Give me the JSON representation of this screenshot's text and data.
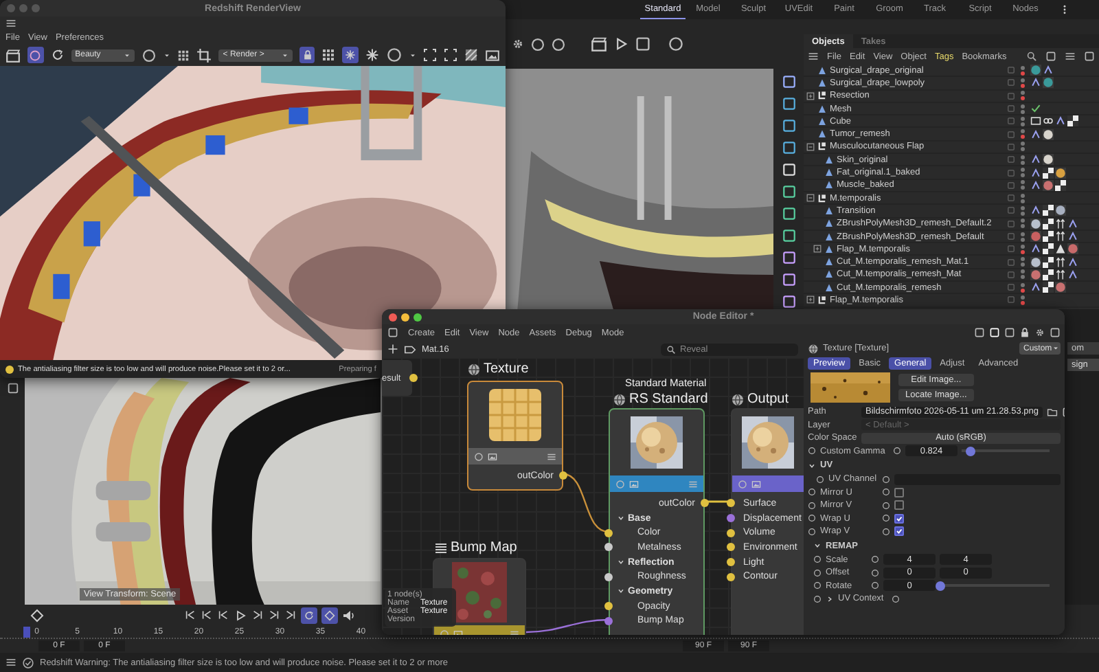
{
  "modes": [
    {
      "label": "Standard",
      "selected": true
    },
    {
      "label": "Model",
      "selected": false
    },
    {
      "label": "Sculpt",
      "selected": false
    },
    {
      "label": "UVEdit",
      "selected": false
    },
    {
      "label": "Paint",
      "selected": false
    },
    {
      "label": "Groom",
      "selected": false
    },
    {
      "label": "Track",
      "selected": false
    },
    {
      "label": "Script",
      "selected": false
    },
    {
      "label": "Nodes",
      "selected": false
    }
  ],
  "viewport": {
    "overlay_label": "View Transform: Scene"
  },
  "objects_panel": {
    "tabs": [
      {
        "label": "Objects",
        "selected": true
      },
      {
        "label": "Takes",
        "selected": false
      }
    ],
    "menu": [
      {
        "label": "File",
        "highlighted": false
      },
      {
        "label": "Edit",
        "highlighted": false
      },
      {
        "label": "View",
        "highlighted": false
      },
      {
        "label": "Object",
        "highlighted": false
      },
      {
        "label": "Tags",
        "highlighted": true
      },
      {
        "label": "Bookmarks",
        "highlighted": false
      }
    ],
    "items": [
      {
        "name": "Surgical_drape_original",
        "kind": "mesh",
        "render_off": true,
        "tags": [
          {
            "kind": "material",
            "color": "#3a9a9a"
          },
          {
            "kind": "uv"
          }
        ]
      },
      {
        "name": "Surgical_drape_lowpoly",
        "kind": "mesh",
        "render_off": true,
        "tags": [
          {
            "kind": "uv"
          },
          {
            "kind": "material",
            "color": "#3a9a9a"
          }
        ]
      },
      {
        "name": "Resection",
        "kind": "group",
        "render_off": true,
        "expanded": false
      },
      {
        "name": "Mesh",
        "kind": "mesh",
        "render_off": false,
        "tags": [
          {
            "kind": "check"
          }
        ]
      },
      {
        "name": "Cube",
        "kind": "mesh",
        "render_off": false,
        "tags": [
          {
            "kind": "display"
          },
          {
            "kind": "compositing"
          },
          {
            "kind": "uv"
          },
          {
            "kind": "checker"
          }
        ]
      },
      {
        "name": "Tumor_remesh",
        "kind": "mesh",
        "render_off": true,
        "tags": [
          {
            "kind": "uv"
          },
          {
            "kind": "material",
            "color": "#d8d4cc"
          }
        ]
      },
      {
        "name": "Musculocutaneous Flap",
        "kind": "group",
        "render_off": false,
        "expanded": true,
        "children": [
          {
            "name": "Skin_original",
            "kind": "mesh",
            "render_off": false,
            "tags": [
              {
                "kind": "uv"
              },
              {
                "kind": "material",
                "color": "#d8d4cc"
              }
            ]
          },
          {
            "name": "Fat_original.1_baked",
            "kind": "mesh",
            "render_off": false,
            "tags": [
              {
                "kind": "uv"
              },
              {
                "kind": "checker"
              },
              {
                "kind": "material",
                "color": "#d8a040"
              }
            ]
          },
          {
            "name": "Muscle_baked",
            "kind": "mesh",
            "render_off": false,
            "tags": [
              {
                "kind": "uv"
              },
              {
                "kind": "material",
                "color": "#c87070"
              },
              {
                "kind": "checker"
              }
            ]
          }
        ]
      },
      {
        "name": "M.temporalis",
        "kind": "group",
        "render_off": false,
        "expanded": true,
        "children": [
          {
            "name": "Transition",
            "kind": "mesh",
            "render_off": false,
            "tags": [
              {
                "kind": "uv"
              },
              {
                "kind": "checker"
              },
              {
                "kind": "material",
                "color": "#a8b0c0"
              }
            ]
          },
          {
            "name": "ZBrushPolyMesh3D_remesh_Default.2",
            "kind": "mesh",
            "render_off": false,
            "tags": [
              {
                "kind": "material",
                "color": "#b8c0cc"
              },
              {
                "kind": "checker"
              },
              {
                "kind": "align"
              },
              {
                "kind": "uv"
              }
            ]
          },
          {
            "name": "ZBrushPolyMesh3D_remesh_Default",
            "kind": "mesh",
            "render_off": false,
            "tags": [
              {
                "kind": "material",
                "color": "#c86060"
              },
              {
                "kind": "checker"
              },
              {
                "kind": "align"
              },
              {
                "kind": "uv"
              }
            ]
          },
          {
            "name": "Flap_M.temporalis",
            "kind": "mesh",
            "render_off": true,
            "expanded": false,
            "tags": [
              {
                "kind": "uv"
              },
              {
                "kind": "checker"
              },
              {
                "kind": "warning"
              },
              {
                "kind": "material",
                "color": "#c86a6a"
              }
            ]
          },
          {
            "name": "Cut_M.temporalis_remesh_Mat.1",
            "kind": "mesh",
            "render_off": false,
            "tags": [
              {
                "kind": "material",
                "color": "#b8c0cc"
              },
              {
                "kind": "checker"
              },
              {
                "kind": "align"
              },
              {
                "kind": "uv"
              }
            ]
          },
          {
            "name": "Cut_M.temporalis_remesh_Mat",
            "kind": "mesh",
            "render_off": false,
            "tags": [
              {
                "kind": "material",
                "color": "#c87070"
              },
              {
                "kind": "checker"
              },
              {
                "kind": "align"
              },
              {
                "kind": "uv"
              }
            ]
          },
          {
            "name": "Cut_M.temporalis_remesh",
            "kind": "mesh",
            "render_off": true,
            "tags": [
              {
                "kind": "uv"
              },
              {
                "kind": "checker"
              },
              {
                "kind": "material",
                "color": "#c87070"
              }
            ]
          }
        ]
      },
      {
        "name": "Flap_M.temporalis",
        "kind": "group",
        "render_off": true,
        "expanded": false
      }
    ]
  },
  "side_panel": {
    "dropdown": "om",
    "button": "sign"
  },
  "timeline": {
    "ticks": [
      "0",
      "5",
      "10",
      "15",
      "20",
      "25",
      "30",
      "35",
      "40"
    ],
    "start_fields": [
      "0 F",
      "0 F"
    ],
    "end_fields": [
      "90 F",
      "90 F"
    ]
  },
  "status_bar": {
    "message": "Redshift Warning: The antialiasing filter size is too low and will produce noise. Please set it to 2 or more"
  },
  "render_view": {
    "title": "Redshift RenderView",
    "menu": [
      "File",
      "View",
      "Preferences"
    ],
    "aov": "Beauty",
    "camera": "< Render >",
    "warning": "The antialiasing filter size is too low and will produce noise.Please set it to 2 or...",
    "progress": "Preparing f"
  },
  "node_editor": {
    "title": "Node Editor *",
    "menu": [
      "Create",
      "Edit",
      "View",
      "Node",
      "Assets",
      "Debug",
      "Mode"
    ],
    "material": "Mat.16",
    "search_placeholder": "Reveal",
    "nodes": [
      {
        "kind": "result",
        "title": "esult"
      },
      {
        "kind": "texture",
        "title": "Texture",
        "output": "outColor"
      },
      {
        "kind": "material",
        "subtitle": "Standard Material",
        "title": "RS Standard",
        "output": "outColor",
        "inputs": [
          {
            "kind": "group",
            "label": "Base"
          },
          {
            "kind": "port",
            "label": "Color",
            "color": "#e0c040"
          },
          {
            "kind": "port",
            "label": "Metalness",
            "color": "#c8c8c8"
          },
          {
            "kind": "group",
            "label": "Reflection"
          },
          {
            "kind": "port",
            "label": "Roughness",
            "color": "#c8c8c8"
          },
          {
            "kind": "group",
            "label": "Geometry"
          },
          {
            "kind": "port",
            "label": "Opacity",
            "color": "#e0c040"
          },
          {
            "kind": "port",
            "label": "Bump Map",
            "color": "#9a70d8"
          }
        ]
      },
      {
        "kind": "output",
        "title": "Output",
        "inputs": [
          {
            "kind": "port",
            "label": "Surface",
            "color": "#e0c040"
          },
          {
            "kind": "port",
            "label": "Displacement",
            "color": "#9a70d8"
          },
          {
            "kind": "port",
            "label": "Volume",
            "color": "#e0c040"
          },
          {
            "kind": "port",
            "label": "Environment",
            "color": "#e0c040"
          },
          {
            "kind": "port",
            "label": "Light",
            "color": "#e0c040"
          },
          {
            "kind": "port",
            "label": "Contour",
            "color": "#e0c040"
          }
        ]
      },
      {
        "kind": "bump",
        "title": "Bump Map"
      }
    ],
    "info": {
      "count": "1 node(s)",
      "rows": [
        {
          "label": "Name",
          "value": "Texture"
        },
        {
          "label": "Asset",
          "value": "Texture"
        },
        {
          "label": "Version"
        }
      ]
    },
    "attributes": {
      "title": "Texture [Texture]",
      "preset": "Custom",
      "tabs": [
        {
          "label": "Preview",
          "selected": true
        },
        {
          "label": "Basic",
          "selected": false
        },
        {
          "label": "General",
          "selected": true
        },
        {
          "label": "Adjust",
          "selected": false
        },
        {
          "label": "Advanced",
          "selected": false
        }
      ],
      "image_buttons": [
        "Edit Image...",
        "Locate Image..."
      ],
      "fields": [
        {
          "kind": "path",
          "label": "Path",
          "value": "Bildschirmfoto 2026-05-11 um 21.28.53.png"
        },
        {
          "kind": "select",
          "label": "Layer",
          "value": "< Default >"
        },
        {
          "kind": "button",
          "label": "Color Space",
          "value": "Auto (sRGB)"
        },
        {
          "kind": "slider",
          "label": "Custom Gamma",
          "value": "0.824",
          "level": 0.1
        }
      ],
      "sections": [
        {
          "title": "UV",
          "expanded": true,
          "rows": [
            {
              "kind": "field",
              "label": "UV Channel"
            },
            {
              "kind": "checkbox",
              "label": "Mirror U",
              "checked": false
            },
            {
              "kind": "checkbox",
              "label": "Mirror V",
              "checked": false
            },
            {
              "kind": "checkbox",
              "label": "Wrap U",
              "checked": true
            },
            {
              "kind": "checkbox",
              "label": "Wrap V",
              "checked": true
            }
          ]
        },
        {
          "title": "REMAP",
          "expanded": true,
          "rows": [
            {
              "kind": "pair",
              "label": "Scale",
              "values": [
                "4",
                "4"
              ]
            },
            {
              "kind": "pair",
              "label": "Offset",
              "values": [
                "0",
                "0"
              ]
            },
            {
              "kind": "slider",
              "label": "Rotate",
              "value": "0",
              "level": 0
            },
            {
              "kind": "group",
              "label": "UV Context",
              "expanded": false
            }
          ]
        }
      ]
    }
  }
}
